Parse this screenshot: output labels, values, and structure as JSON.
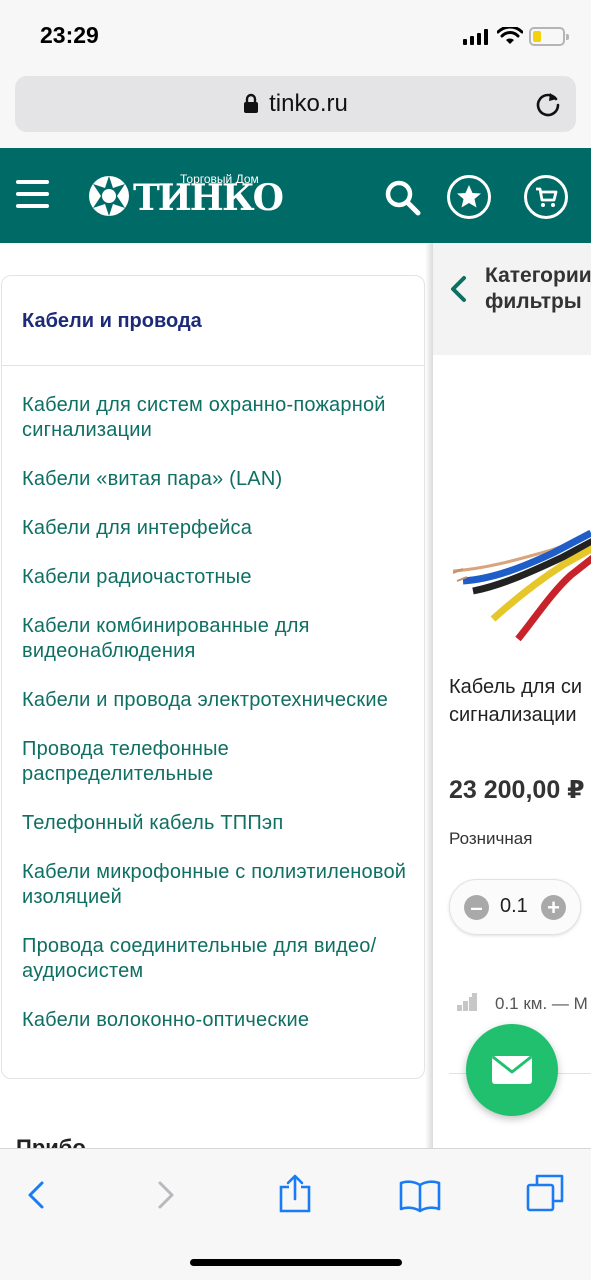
{
  "status_bar": {
    "time": "23:29"
  },
  "browser": {
    "url": "tinko.ru"
  },
  "header": {
    "logo_small": "Торговый Дом",
    "logo_text": "ТИНКО",
    "accent_color": "#006a66"
  },
  "sidebar_menu": {
    "title": "Кабели и провода",
    "items": [
      "Кабели для систем охранно-пожарной сигнализации",
      "Кабели «витая пара» (LAN)",
      "Кабели для интерфейса",
      "Кабели радиочастотные",
      "Кабели комбинированные для видеонаблюдения",
      "Кабели и провода электротехнические",
      "Провода телефонные распределительные",
      "Телефонный кабель ТППэп",
      "Кабели микрофонные с полиэтиленовой изоляцией",
      "Провода соединительные для видео/аудиосистем",
      "Кабели волоконно-оптические"
    ],
    "link_color": "#0e6f63",
    "title_color": "#1c2a7a"
  },
  "product_pane": {
    "breadcrumb": "Категории\nфильтры",
    "product_name": "Кабель для си\nсигнализации",
    "price": "23 200,00 ₽",
    "price_type": "Розничная",
    "quantity": "0.1",
    "stock": "0.1 км. — М"
  },
  "left_peek_text": "Прибо",
  "icons": [
    "lock-icon",
    "reload-icon",
    "menu-icon",
    "search-icon",
    "star-icon",
    "cart-icon",
    "back-chevron-icon",
    "minus-icon",
    "plus-icon",
    "stock-level-icon",
    "mail-icon",
    "back-arrow-icon",
    "forward-arrow-icon",
    "share-icon",
    "bookmarks-icon",
    "tabs-icon"
  ]
}
